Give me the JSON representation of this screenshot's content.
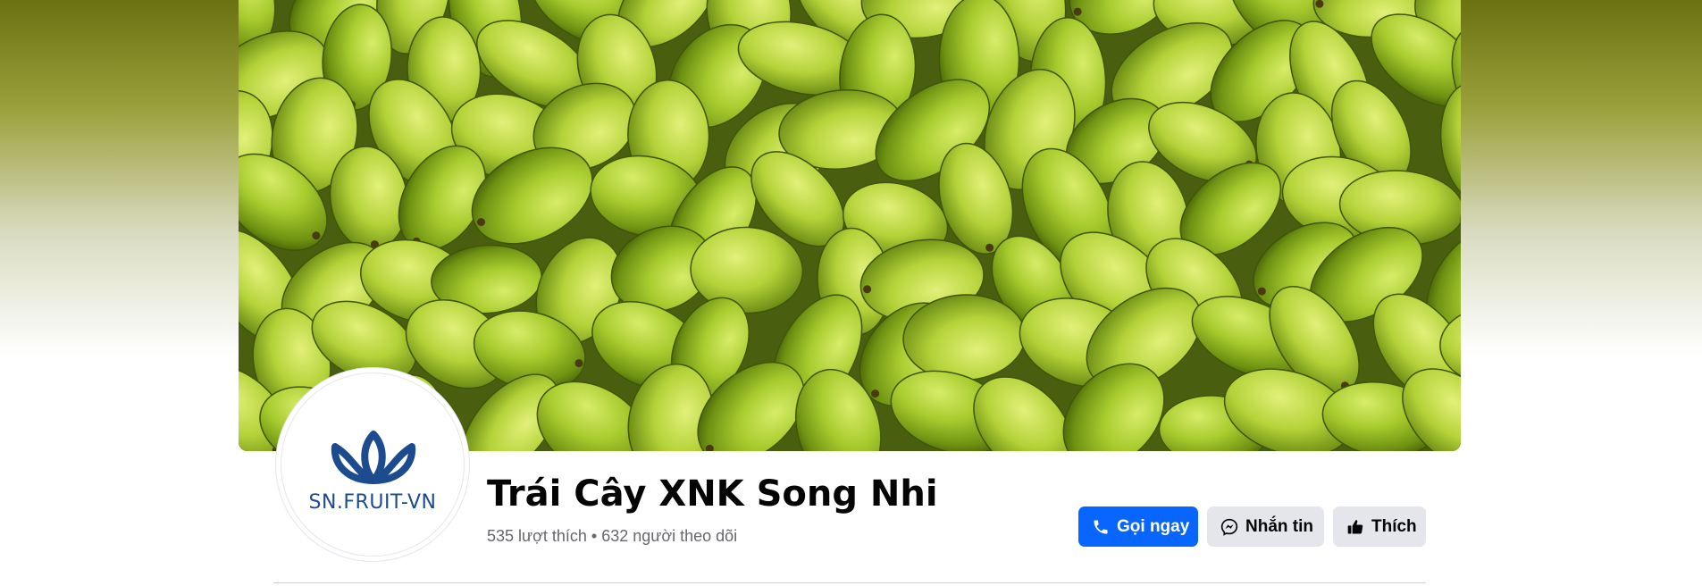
{
  "page": {
    "name": "Trái Cây XNK Song Nhi",
    "stats": "535 lượt thích • 632 người theo dõi"
  },
  "profile": {
    "logo_text": "SN.FRUIT-VN",
    "logo_color": "#1d4b8f"
  },
  "actions": {
    "call_label": "Gọi ngay",
    "message_label": "Nhắn tin",
    "like_label": "Thích"
  },
  "colors": {
    "primary": "#0866ff",
    "secondary_button": "#e4e6eb",
    "text_primary": "#050505",
    "text_secondary": "#65676b"
  },
  "icons": {
    "call": "phone-icon",
    "message": "messenger-icon",
    "like": "thumbs-up-icon"
  }
}
